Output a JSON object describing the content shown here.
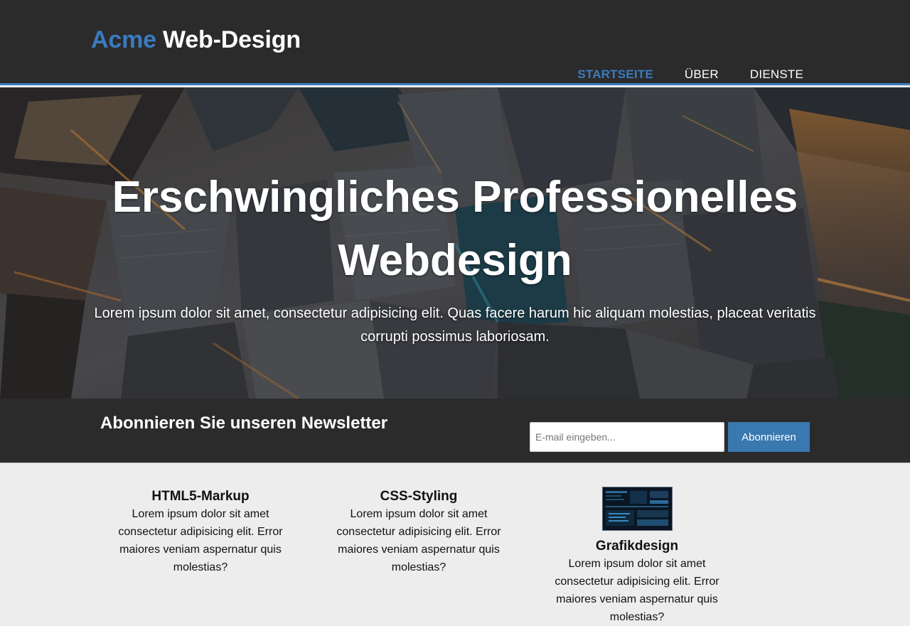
{
  "header": {
    "brand_highlight": "Acme",
    "brand_rest": " Web-Design",
    "nav": [
      {
        "label": "STARTSEITE",
        "current": true
      },
      {
        "label": "ÜBER",
        "current": false
      },
      {
        "label": "DIENSTE",
        "current": false
      }
    ]
  },
  "showcase": {
    "title": "Erschwingliches Professionelles Webdesign",
    "text": "Lorem ipsum dolor sit amet, consectetur adipisicing elit. Quas facere harum hic aliquam molestias, placeat veritatis corrupti possimus laboriosam."
  },
  "newsletter": {
    "title": "Abonnieren Sie unseren Newsletter",
    "email_placeholder": "E-mail eingeben...",
    "button_label": "Abonnieren"
  },
  "boxes": [
    {
      "title": "HTML5-Markup",
      "text": "Lorem ipsum dolor sit amet consectetur adipisicing elit. Error maiores veniam aspernatur quis molestias?"
    },
    {
      "title": "CSS-Styling",
      "text": "Lorem ipsum dolor sit amet consectetur adipisicing elit. Error maiores veniam aspernatur quis molestias?"
    },
    {
      "title": "Grafikdesign",
      "text": "Lorem ipsum dolor sit amet consectetur adipisicing elit. Error maiores veniam aspernatur quis molestias?"
    }
  ],
  "colors": {
    "accent": "#3a7bbf",
    "dark_background": "#2b2b2b",
    "light_background": "#ededed",
    "button": "#3a78b0"
  }
}
